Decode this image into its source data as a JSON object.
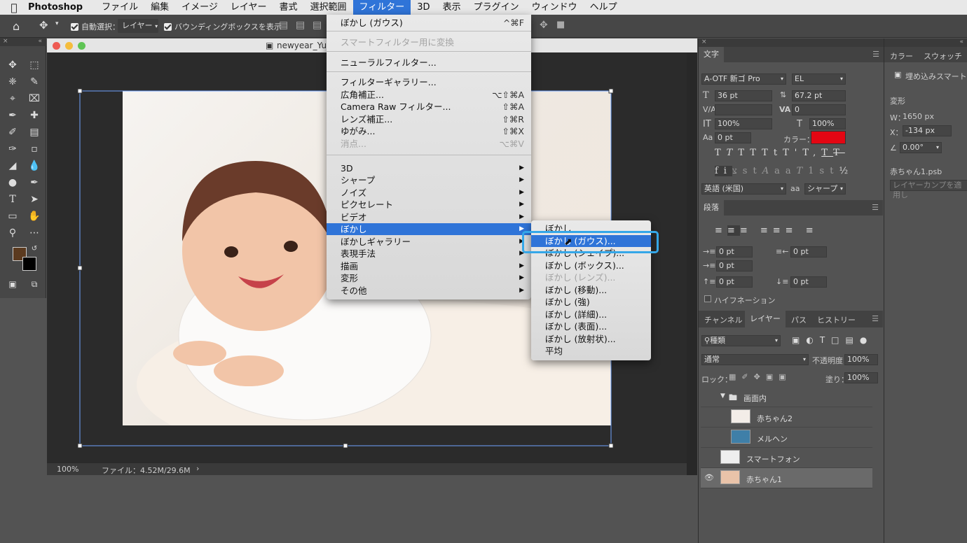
{
  "menubar": {
    "app": "Photoshop",
    "items": [
      "ファイル",
      "編集",
      "イメージ",
      "レイヤー",
      "書式",
      "選択範囲",
      "フィルター",
      "3D",
      "表示",
      "プラグイン",
      "ウィンドウ",
      "ヘルプ"
    ],
    "active": "フィルター"
  },
  "options": {
    "auto_select_label": "自動選択：",
    "auto_select_value": "レイヤー",
    "bbox_label": "バウンディングボックスを表示"
  },
  "document": {
    "title": "newyear_Yuji",
    "zoom": "100%",
    "file_info": "ファイル：4.52M/29.6M"
  },
  "filter_menu": {
    "items": [
      {
        "label": "ぼかし (ガウス)",
        "shortcut": "^⌘F"
      },
      {
        "label": "スマートフィルター用に変換",
        "disabled": true
      },
      {
        "label": "ニューラルフィルター..."
      },
      {
        "label": "フィルターギャラリー..."
      },
      {
        "label": "広角補正...",
        "shortcut": "⌥⇧⌘A"
      },
      {
        "label": "Camera Raw フィルター...",
        "shortcut": "⇧⌘A"
      },
      {
        "label": "レンズ補正...",
        "shortcut": "⇧⌘R"
      },
      {
        "label": "ゆがみ...",
        "shortcut": "⇧⌘X"
      },
      {
        "label": "消点...",
        "shortcut": "⌥⌘V",
        "disabled": true
      },
      {
        "label": "3D",
        "submenu": true
      },
      {
        "label": "シャープ",
        "submenu": true
      },
      {
        "label": "ノイズ",
        "submenu": true
      },
      {
        "label": "ピクセレート",
        "submenu": true
      },
      {
        "label": "ビデオ",
        "submenu": true
      },
      {
        "label": "ぼかし",
        "submenu": true,
        "highlighted": true
      },
      {
        "label": "ぼかしギャラリー",
        "submenu": true
      },
      {
        "label": "表現手法",
        "submenu": true
      },
      {
        "label": "描画",
        "submenu": true
      },
      {
        "label": "変形",
        "submenu": true
      },
      {
        "label": "その他",
        "submenu": true
      }
    ]
  },
  "blur_submenu": {
    "items": [
      {
        "label": "ぼかし"
      },
      {
        "label": "ぼかし (ガウス)...",
        "highlighted": true
      },
      {
        "label": "ぼかし (シェイプ)..."
      },
      {
        "label": "ぼかし (ボックス)..."
      },
      {
        "label": "ぼかし (レンズ)...",
        "disabled": true
      },
      {
        "label": "ぼかし (移動)..."
      },
      {
        "label": "ぼかし (強)"
      },
      {
        "label": "ぼかし (詳細)..."
      },
      {
        "label": "ぼかし (表面)..."
      },
      {
        "label": "ぼかし (放射状)..."
      },
      {
        "label": "平均"
      }
    ]
  },
  "character_panel": {
    "tab": "文字",
    "font_family": "A-OTF 新ゴ Pro",
    "font_style": "EL",
    "size": "36 pt",
    "leading": "67.2 pt",
    "tracking": "0",
    "vscale": "100%",
    "hscale": "100%",
    "baseline": "0 pt",
    "color_label": "カラー：",
    "color": "#e30613",
    "language": "英語 (米国)",
    "aa_label": "a",
    "antialias": "シャープ"
  },
  "paragraph_panel": {
    "tab": "段落",
    "indent_left": "0 pt",
    "indent_right": "0 pt",
    "indent_first": "0 pt",
    "space_before": "0 pt",
    "space_after": "0 pt",
    "hyphenation": "ハイフネーション"
  },
  "properties_panel": {
    "tabs": [
      "カラー",
      "スウォッチ"
    ],
    "object": "埋め込みスマートオ",
    "section": "変形",
    "w_label": "W：",
    "w_value": "1650 px",
    "x_label": "X：",
    "x_value": "-134 px",
    "angle": "0.00°",
    "file": "赤ちゃん1.psb",
    "comp": "レイヤーカンプを適用し"
  },
  "layers_panel": {
    "tabs": [
      "チャンネル",
      "レイヤー",
      "パス",
      "ヒストリー"
    ],
    "active_tab": "レイヤー",
    "filter": "種類",
    "blend_mode": "通常",
    "opacity_label": "不透明度：",
    "opacity": "100%",
    "lock_label": "ロック：",
    "fill_label": "塗り：",
    "fill": "100%",
    "layers": [
      {
        "name": "画面内",
        "type": "group"
      },
      {
        "name": "赤ちゃん2",
        "type": "layer"
      },
      {
        "name": "メルヘン",
        "type": "layer"
      },
      {
        "name": "スマートフォン",
        "type": "layer"
      },
      {
        "name": "赤ちゃん1",
        "type": "layer",
        "selected": true,
        "visible": true
      }
    ]
  }
}
